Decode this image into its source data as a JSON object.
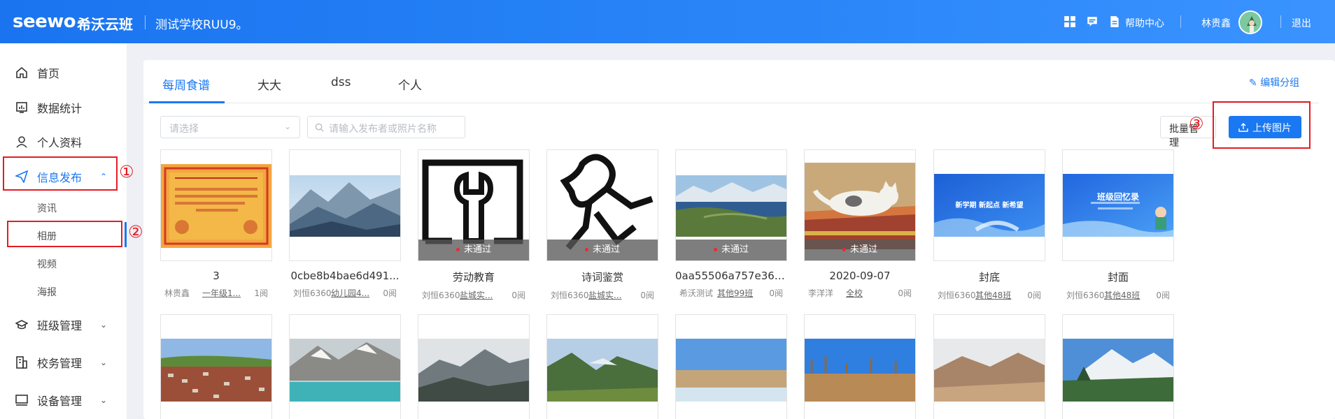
{
  "header": {
    "logo": "seewo",
    "product": "希沃云班",
    "school": "测试学校RUU9。",
    "help": "帮助中心",
    "user": "林贵鑫",
    "logout": "退出"
  },
  "sidebar": {
    "items": [
      {
        "label": "首页",
        "icon": "home-icon"
      },
      {
        "label": "数据统计",
        "icon": "chart-icon"
      },
      {
        "label": "个人资料",
        "icon": "user-icon"
      },
      {
        "label": "信息发布",
        "icon": "send-icon"
      },
      {
        "label": "班级管理",
        "icon": "class-icon"
      },
      {
        "label": "校务管理",
        "icon": "school-affairs-icon"
      },
      {
        "label": "设备管理",
        "icon": "device-icon"
      }
    ],
    "sub_items": [
      "资讯",
      "相册",
      "视频",
      "海报"
    ]
  },
  "annotations": [
    "①",
    "②",
    "③"
  ],
  "tabs": [
    "每周食谱",
    "大大",
    "dss",
    "个人"
  ],
  "toolbar": {
    "edit_group": "编辑分组",
    "select_placeholder": "请选择",
    "search_placeholder": "请输入发布者或照片名称",
    "batch": "批量管理",
    "upload": "上传图片"
  },
  "status_label": "未通过",
  "photos": [
    {
      "title": "3",
      "author": "林贵鑫",
      "class": "一年级1...",
      "reads": "1阅",
      "rejected": false
    },
    {
      "title": "0cbe8b4bae6d491...",
      "author": "刘恒6360",
      "class": "幼儿园4...",
      "reads": "0阅",
      "rejected": false
    },
    {
      "title": "劳动教育",
      "author": "刘恒6360",
      "class": "盐城实...",
      "reads": "0阅",
      "rejected": true
    },
    {
      "title": "诗词鉴赏",
      "author": "刘恒6360",
      "class": "盐城实...",
      "reads": "0阅",
      "rejected": true
    },
    {
      "title": "0aa55506a757e364...",
      "author": "希沃测试",
      "class": "其他99班",
      "reads": "0阅",
      "rejected": true
    },
    {
      "title": "2020-09-07",
      "author": "李洋洋",
      "class": "全校",
      "reads": "0阅",
      "rejected": true
    },
    {
      "title": "封底",
      "author": "刘恒6360",
      "class": "其他48班",
      "reads": "0阅",
      "rejected": false
    },
    {
      "title": "封面",
      "author": "刘恒6360",
      "class": "其他48班",
      "reads": "0阅",
      "rejected": false
    }
  ],
  "banner_texts": {
    "fengdi": "新学期  新起点  新希望",
    "fengmian": "班级回忆录"
  },
  "certificate_text": "林贵鑫"
}
